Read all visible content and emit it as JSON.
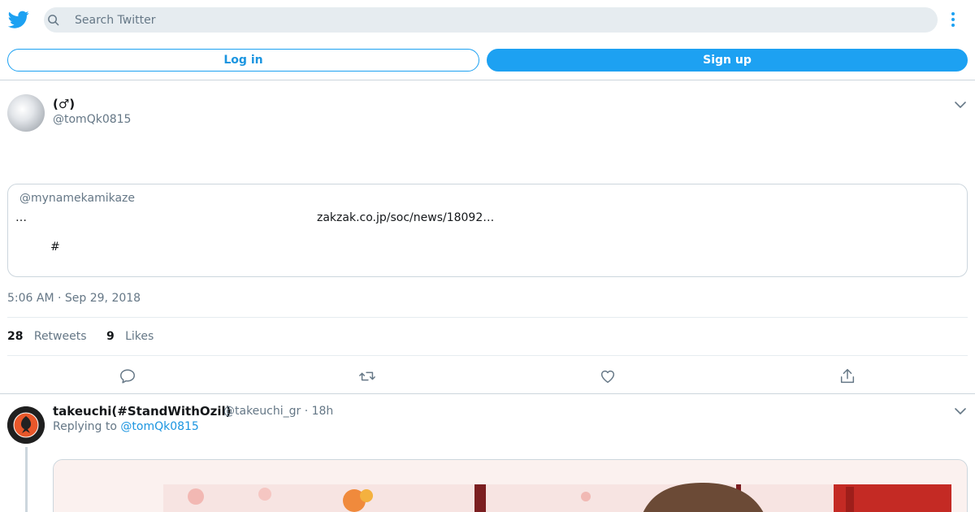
{
  "search": {
    "placeholder": "Search Twitter"
  },
  "auth": {
    "login_label": "Log in",
    "signup_label": "Sign up"
  },
  "tweet": {
    "display_name": "(♂)",
    "handle": "@tomQk0815",
    "quote": {
      "handle": "@mynamekamikaze",
      "ellipsis": "…",
      "link": "zakzak.co.jp/soc/news/18092…",
      "hashtag": "#"
    },
    "timestamp": "5:06 AM · Sep 29, 2018",
    "retweets_count": "28",
    "retweets_label": "Retweets",
    "likes_count": "9",
    "likes_label": "Likes"
  },
  "reply": {
    "display_name": "takeuchi(#StandWithOzil)",
    "meta": "@takeuchi_gr · 18h",
    "replying_prefix": "Replying to",
    "replying_to": "@tomQk0815"
  },
  "icons": {
    "logo": "twitter-bird-icon",
    "search": "search-icon",
    "more": "more-vertical-icon",
    "chevron": "chevron-down-icon",
    "reply": "reply-icon",
    "retweet": "retweet-icon",
    "like": "heart-icon",
    "share": "share-icon"
  },
  "colors": {
    "brand": "#1da1f2",
    "link": "#1b95e0",
    "muted": "#657786",
    "border": "#ccd6dd"
  }
}
